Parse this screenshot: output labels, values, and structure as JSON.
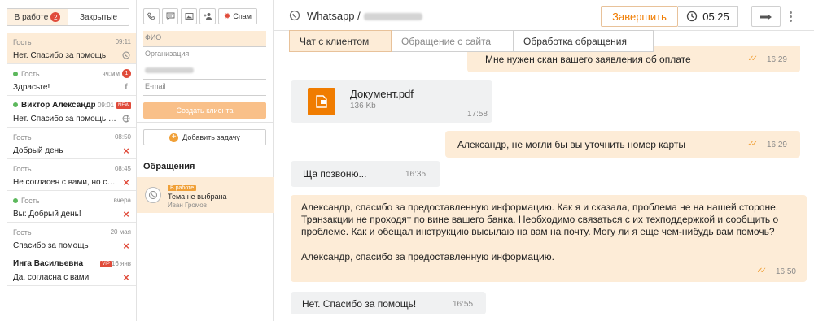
{
  "sidebar": {
    "tabs": [
      {
        "label": "В работе",
        "badge": "2"
      },
      {
        "label": "Закрытые"
      }
    ],
    "chats": [
      {
        "name": "Гость",
        "time": "09:11",
        "preview": "Нет. Спасибо за помощь!",
        "icon": "whatsapp-icon"
      },
      {
        "name": "Гость",
        "time": "чч:мм",
        "preview": "Здрасьте!",
        "icon": "facebook-icon",
        "unread": "1"
      },
      {
        "name": "Виктор Александров...",
        "time": "09:01",
        "preview": "Нет. Спасибо за помощь и ещ...",
        "icon": "globe-icon",
        "tag": "NEW"
      },
      {
        "name": "Гость",
        "time": "08:50",
        "preview": "Добрый день",
        "icon": "close-icon"
      },
      {
        "name": "Гость",
        "time": "08:45",
        "preview": "Не согласен с вами, но соглас...",
        "icon": "close-icon"
      },
      {
        "name": "Гость",
        "time": "вчера",
        "preview": "Вы: Добрый день!",
        "icon": "close-icon"
      },
      {
        "name": "Гость",
        "time": "20 мая",
        "preview": "Спасибо за помощь",
        "icon": "close-icon"
      },
      {
        "name": "Инга Васильевна",
        "time": "16 янв",
        "preview": "Да, согласна с вами",
        "icon": "close-icon",
        "tag": "VIP"
      }
    ]
  },
  "client": {
    "spam_label": "Спам",
    "fields": {
      "fio": "ФИО",
      "org": "Организация",
      "email": "E-mail"
    },
    "create_label": "Создать клиента",
    "add_task_label": "Добавить задачу",
    "appeals_title": "Обращения",
    "appeal": {
      "status": "В работе",
      "title": "Тема не выбрана",
      "user": "Иван Громов"
    }
  },
  "chat": {
    "channel": "Whatsapp /",
    "finish_label": "Завершить",
    "timer": "05:25",
    "tabs": [
      "Чат с клиентом",
      "Обращение с сайта",
      "Обработка обращения"
    ],
    "messages": {
      "m1": {
        "text": "Мне нужен скан вашего заявления об оплате",
        "time": "16:29"
      },
      "m2": {
        "file": "Документ.pdf",
        "size": "136 Kb",
        "time": "17:58"
      },
      "m3": {
        "text": "Александр, не могли бы вы уточнить номер карты",
        "time": "16:29"
      },
      "m4": {
        "text": "Ща позвоню...",
        "time": "16:35"
      },
      "m5": {
        "text": "Александр, спасибо за предоставленную информацию. Как я и сказала, проблема не на нашей стороне. Транзакции не проходят по вине вашего банка. Необходимо связаться с их техподдержкой и сообщить о проблеме. Как и обещал инструкцию высылаю на вам на почту. Могу ли я еще чем-нибудь вам помочь?",
        "text2": "Александр, спасибо за предоставленную информацию.",
        "time": "16:50"
      },
      "m6": {
        "text": "Нет. Спасибо за помощь!",
        "time": "16:55"
      }
    }
  },
  "colors": {
    "accent": "#f07c00",
    "out_bubble": "#fdecd7",
    "in_bubble": "#f0f1f2",
    "badge": "#e04b3a",
    "online": "#5cb85c"
  }
}
